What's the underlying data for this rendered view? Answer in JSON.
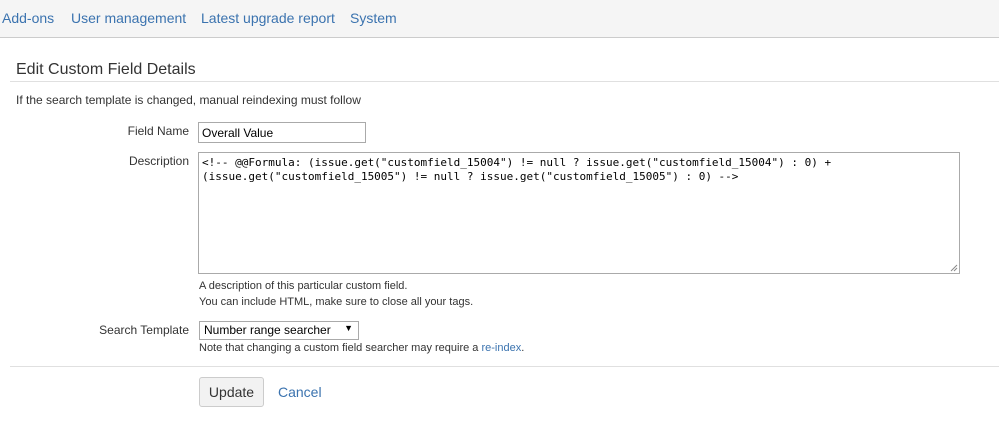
{
  "nav": {
    "items": [
      {
        "label": "Add-ons"
      },
      {
        "label": "User management"
      },
      {
        "label": "Latest upgrade report"
      },
      {
        "label": "System"
      }
    ]
  },
  "page": {
    "title": "Edit Custom Field Details",
    "instructions": "If the search template is changed, manual reindexing must follow"
  },
  "form": {
    "field_name": {
      "label": "Field Name",
      "value": "Overall Value"
    },
    "description": {
      "label": "Description",
      "value": "<!-- @@Formula: (issue.get(\"customfield_15004\") != null ? issue.get(\"customfield_15004\") : 0) +\n(issue.get(\"customfield_15005\") != null ? issue.get(\"customfield_15005\") : 0) -->",
      "help_line1": "A description of this particular custom field.",
      "help_line2": "You can include HTML, make sure to close all your tags."
    },
    "search_template": {
      "label": "Search Template",
      "selected": "Number range searcher",
      "arrow_icon": "▼",
      "help_prefix": "Note that changing a custom field searcher may require a ",
      "help_link": "re-index",
      "help_suffix": "."
    }
  },
  "buttons": {
    "update_label": "Update",
    "cancel_label": "Cancel"
  },
  "colors": {
    "link": "#3b73af",
    "nav_background": "#f5f5f5",
    "text": "#333333"
  }
}
